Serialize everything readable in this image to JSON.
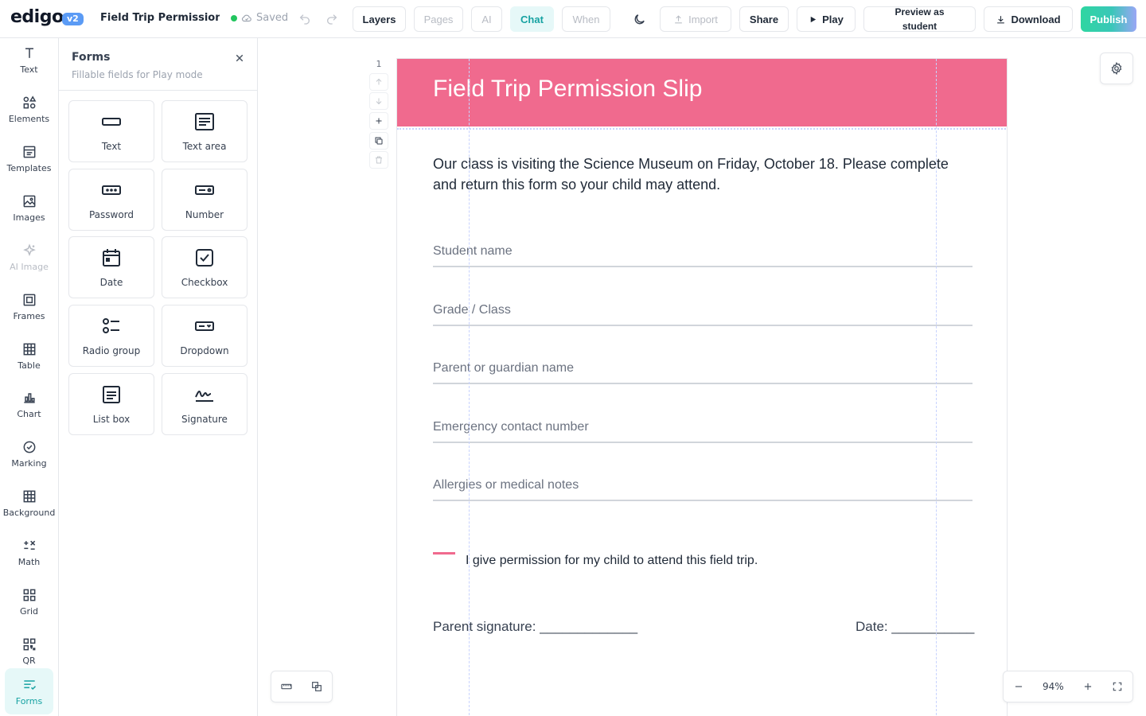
{
  "app": {
    "logo": "edigo",
    "version": "v2",
    "doc_title": "Field Trip Permission Sli",
    "saved_label": "Saved"
  },
  "toolbar": {
    "layers": "Layers",
    "pages": "Pages",
    "ai": "AI",
    "chat": "Chat",
    "when": "When",
    "import": "Import",
    "share": "Share",
    "play": "Play",
    "preview_line1": "Preview as",
    "preview_line2": "student",
    "download": "Download",
    "publish": "Publish"
  },
  "rail": {
    "items": [
      {
        "label": "Text",
        "icon": "text-icon"
      },
      {
        "label": "Elements",
        "icon": "shapes-icon"
      },
      {
        "label": "Templates",
        "icon": "template-icon"
      },
      {
        "label": "Images",
        "icon": "image-icon"
      },
      {
        "label": "AI Image",
        "icon": "sparkle-icon"
      },
      {
        "label": "Frames",
        "icon": "frame-icon"
      },
      {
        "label": "Table",
        "icon": "table-icon"
      },
      {
        "label": "Chart",
        "icon": "chart-icon"
      },
      {
        "label": "Marking",
        "icon": "check-circle-icon"
      },
      {
        "label": "Background",
        "icon": "grid-icon"
      },
      {
        "label": "Math",
        "icon": "math-icon"
      },
      {
        "label": "Grid",
        "icon": "grid-squares-icon"
      },
      {
        "label": "QR",
        "icon": "qr-icon"
      },
      {
        "label": "Forms",
        "icon": "forms-icon"
      }
    ]
  },
  "panel": {
    "title": "Forms",
    "subtitle": "Fillable fields for Play mode",
    "tiles": [
      {
        "label": "Text"
      },
      {
        "label": "Text area"
      },
      {
        "label": "Password"
      },
      {
        "label": "Number"
      },
      {
        "label": "Date"
      },
      {
        "label": "Checkbox"
      },
      {
        "label": "Radio group"
      },
      {
        "label": "Dropdown"
      },
      {
        "label": "List box"
      },
      {
        "label": "Signature"
      }
    ]
  },
  "canvas": {
    "page_number": "1",
    "zoom": "94%",
    "sheet": {
      "title": "Field Trip Permission Slip",
      "intro": "Our class is visiting the Science Museum on Friday, October 18. Please complete and return this form so your child may attend.",
      "fields": [
        "Student name",
        "Grade / Class",
        "Parent or guardian name",
        "Emergency contact number",
        "Allergies or medical notes"
      ],
      "permission": "I give permission for my child to attend this field trip.",
      "signature": "Parent signature: _____________",
      "date": "Date: ___________"
    }
  },
  "colors": {
    "accent": "#17a2a2",
    "header": "#f06a8e",
    "saved_dot": "#22c55e",
    "version_badge": "#5b9bf5"
  }
}
